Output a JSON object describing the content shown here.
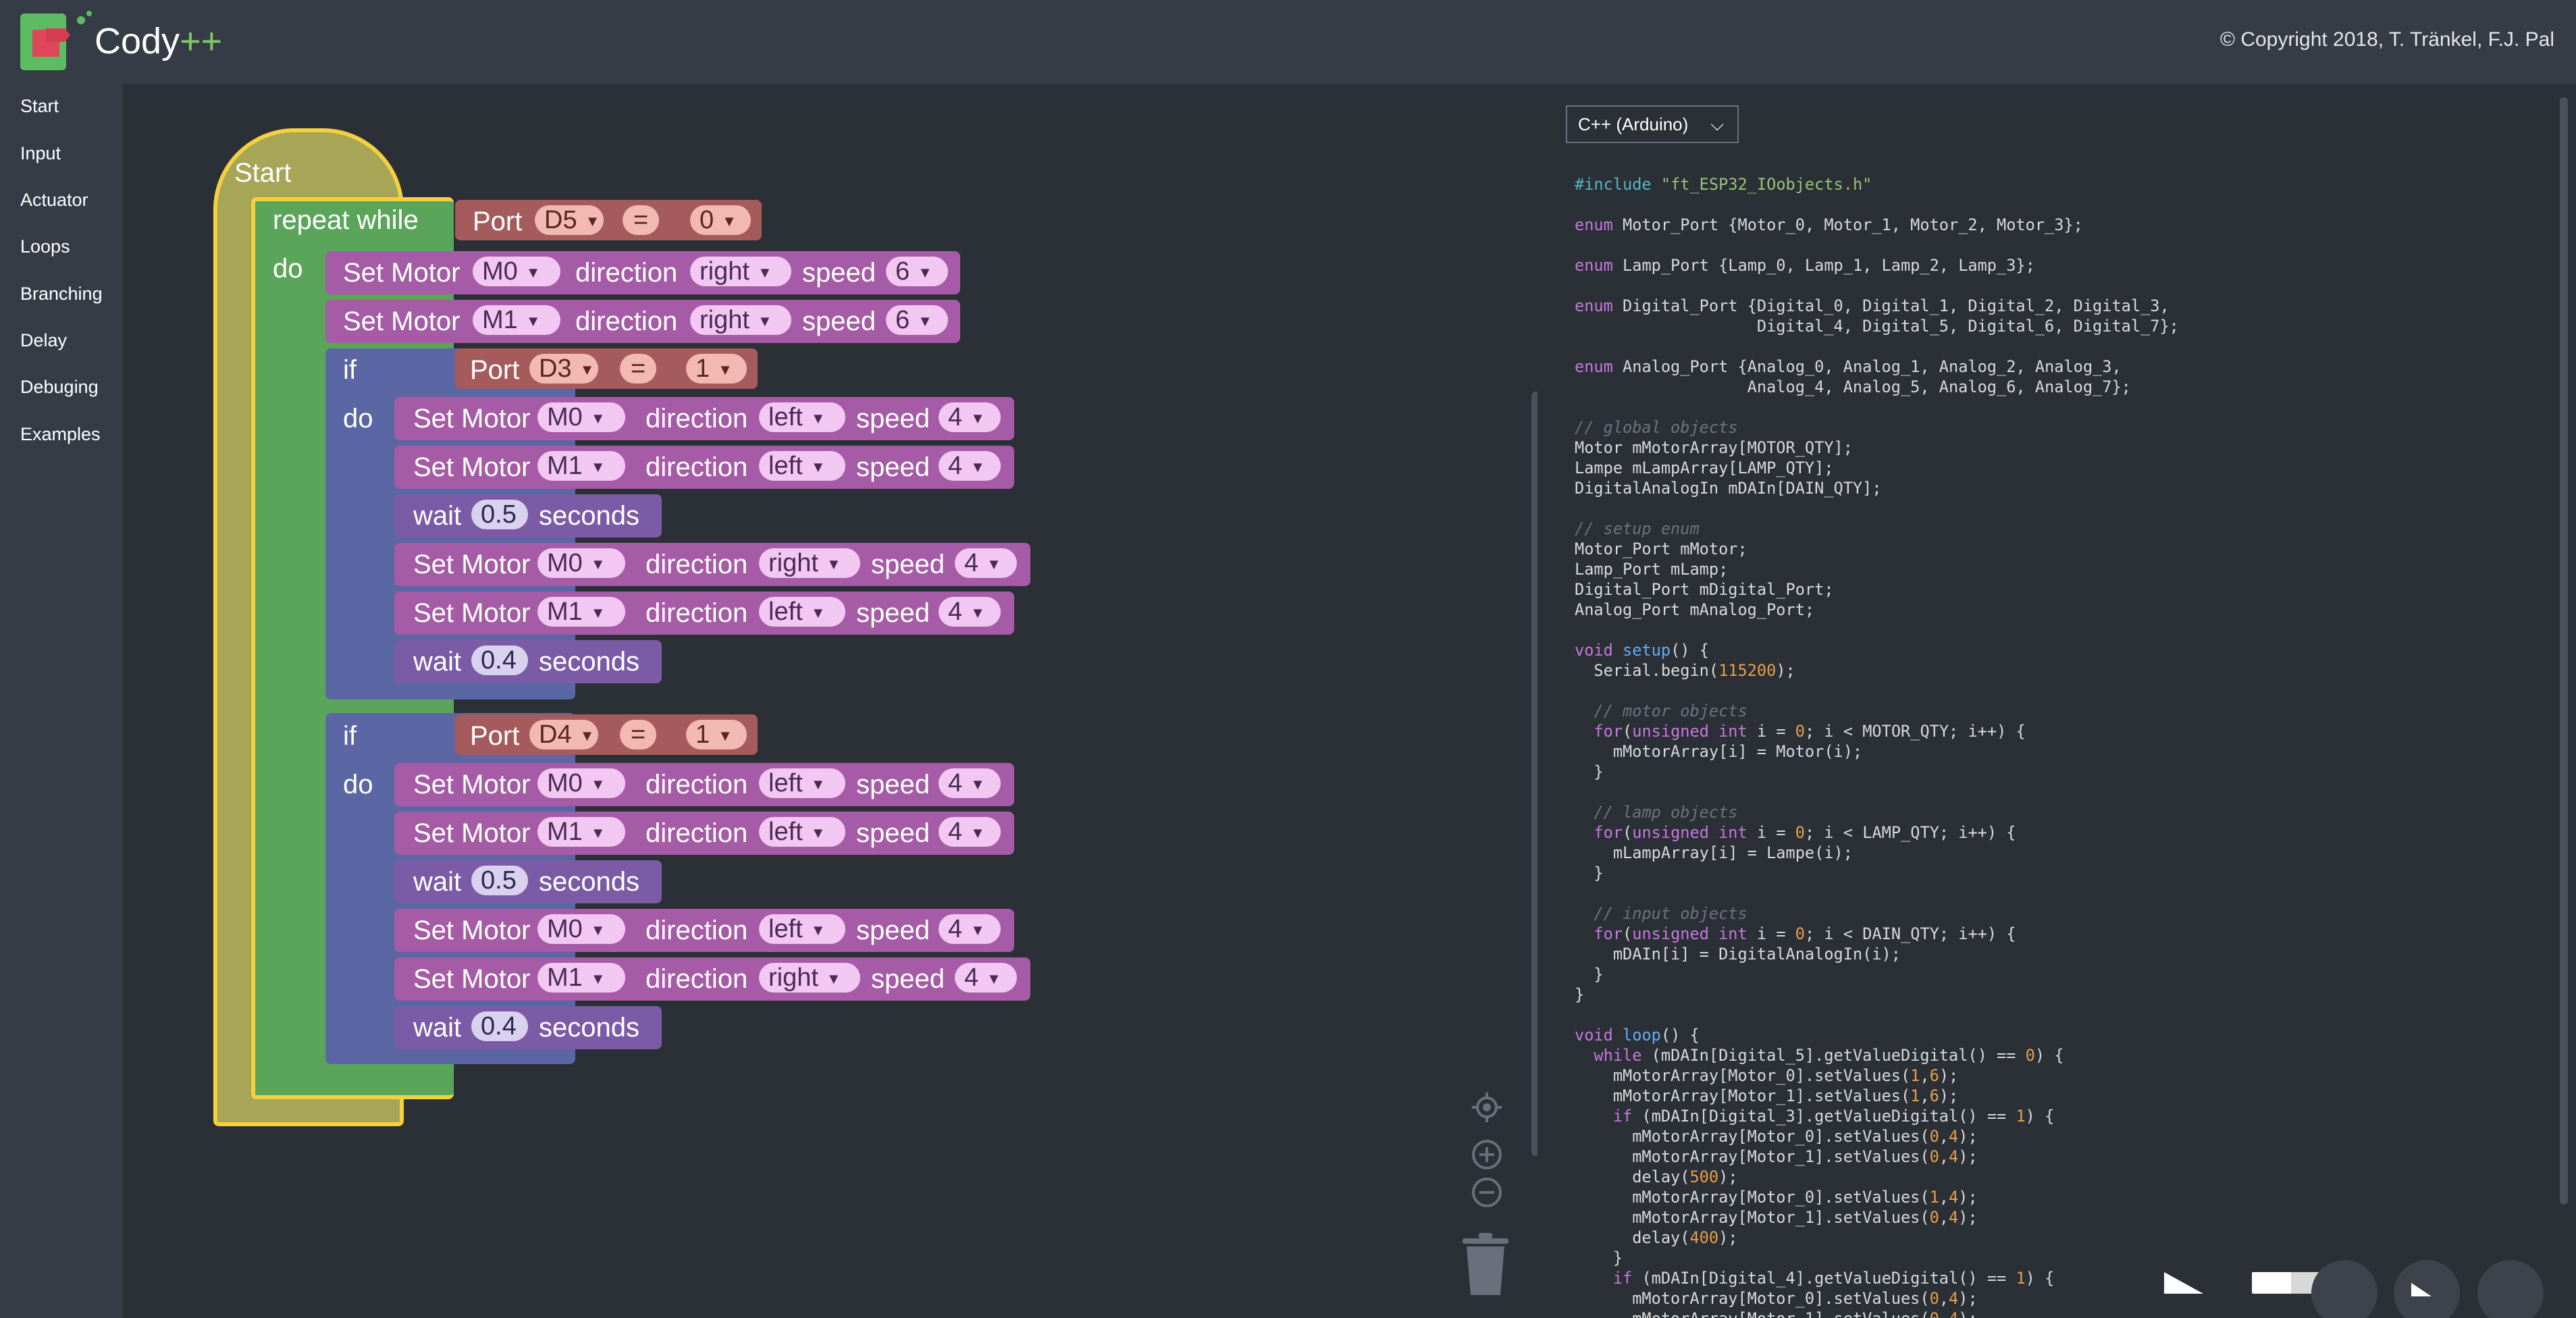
{
  "header": {
    "app_name": "Cody",
    "app_suffix": "++",
    "copyright": "© Copyright 2018, T. Tränkel, F.J. Pal"
  },
  "sidebar": {
    "items": [
      "Start",
      "Input",
      "Actuator",
      "Loops",
      "Branching",
      "Delay",
      "Debuging",
      "Examples"
    ]
  },
  "blocks": {
    "start": "Start",
    "repeat_while": "repeat while",
    "do": "do",
    "if": "if",
    "port": "Port",
    "eq": "=",
    "set_motor": "Set Motor",
    "direction": "direction",
    "speed": "speed",
    "wait": "wait",
    "seconds": "seconds",
    "while_port": "D5",
    "while_val": "0",
    "m0": "M0",
    "m1": "M1",
    "right": "right",
    "left": "left",
    "s6": "6",
    "s4": "4",
    "if1_port": "D3",
    "if1_val": "1",
    "if2_port": "D4",
    "if2_val": "1",
    "w05": "0.5",
    "w04": "0.4"
  },
  "icons": [
    "logo-icon",
    "target-icon",
    "zoom-in-icon",
    "zoom-out-icon",
    "trash-icon",
    "arrow-icon",
    "toggle-icon",
    "circle-button"
  ],
  "code_panel": {
    "language": "C++ (Arduino)"
  }
}
